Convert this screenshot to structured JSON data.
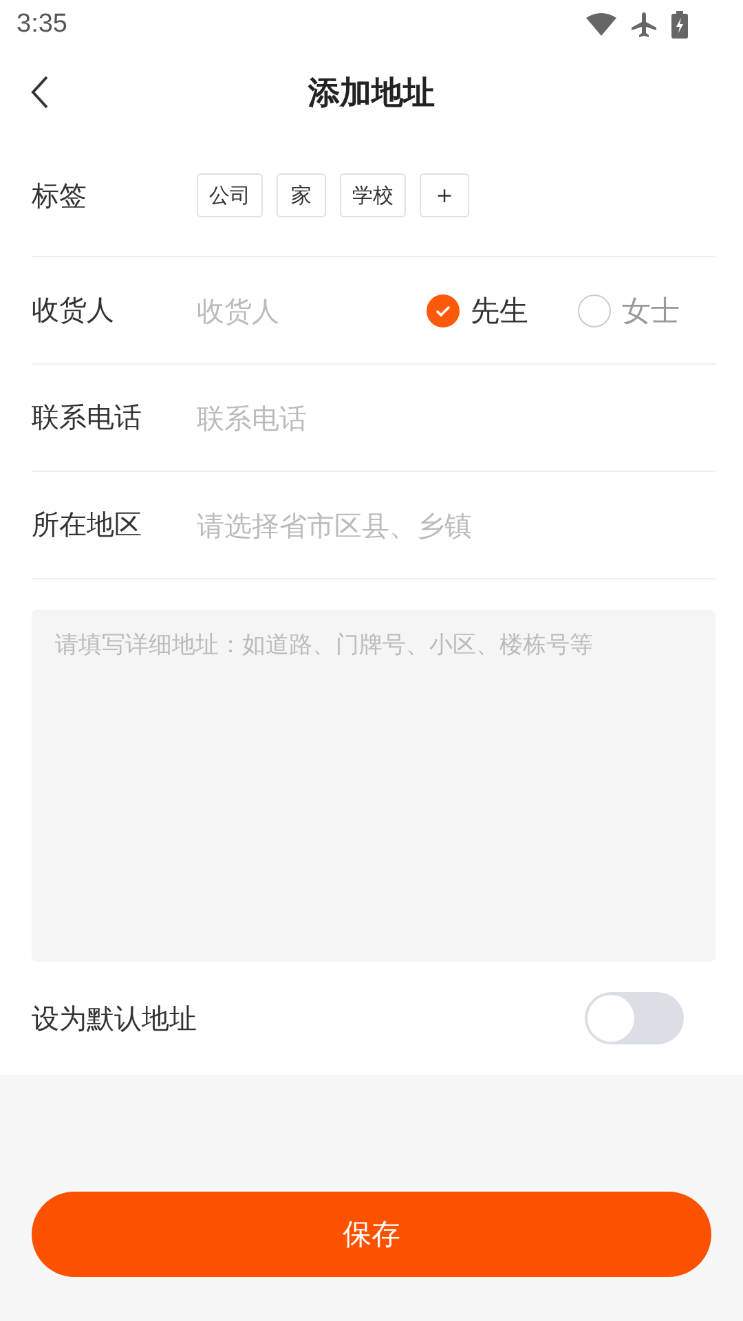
{
  "status_bar": {
    "time": "3:35"
  },
  "header": {
    "title": "添加地址"
  },
  "tags_row": {
    "label": "标签",
    "tags": [
      "公司",
      "家",
      "学校",
      "+"
    ]
  },
  "consignee_row": {
    "label": "收货人",
    "placeholder": "收货人",
    "options": [
      {
        "label": "先生",
        "selected": true
      },
      {
        "label": "女士",
        "selected": false
      }
    ]
  },
  "phone_row": {
    "label": "联系电话",
    "placeholder": "联系电话"
  },
  "region_row": {
    "label": "所在地区",
    "placeholder": "请选择省市区县、乡镇"
  },
  "detail": {
    "placeholder": "请填写详细地址：如道路、门牌号、小区、楼栋号等"
  },
  "default_row": {
    "label": "设为默认地址",
    "on": false
  },
  "save_button": "保存"
}
